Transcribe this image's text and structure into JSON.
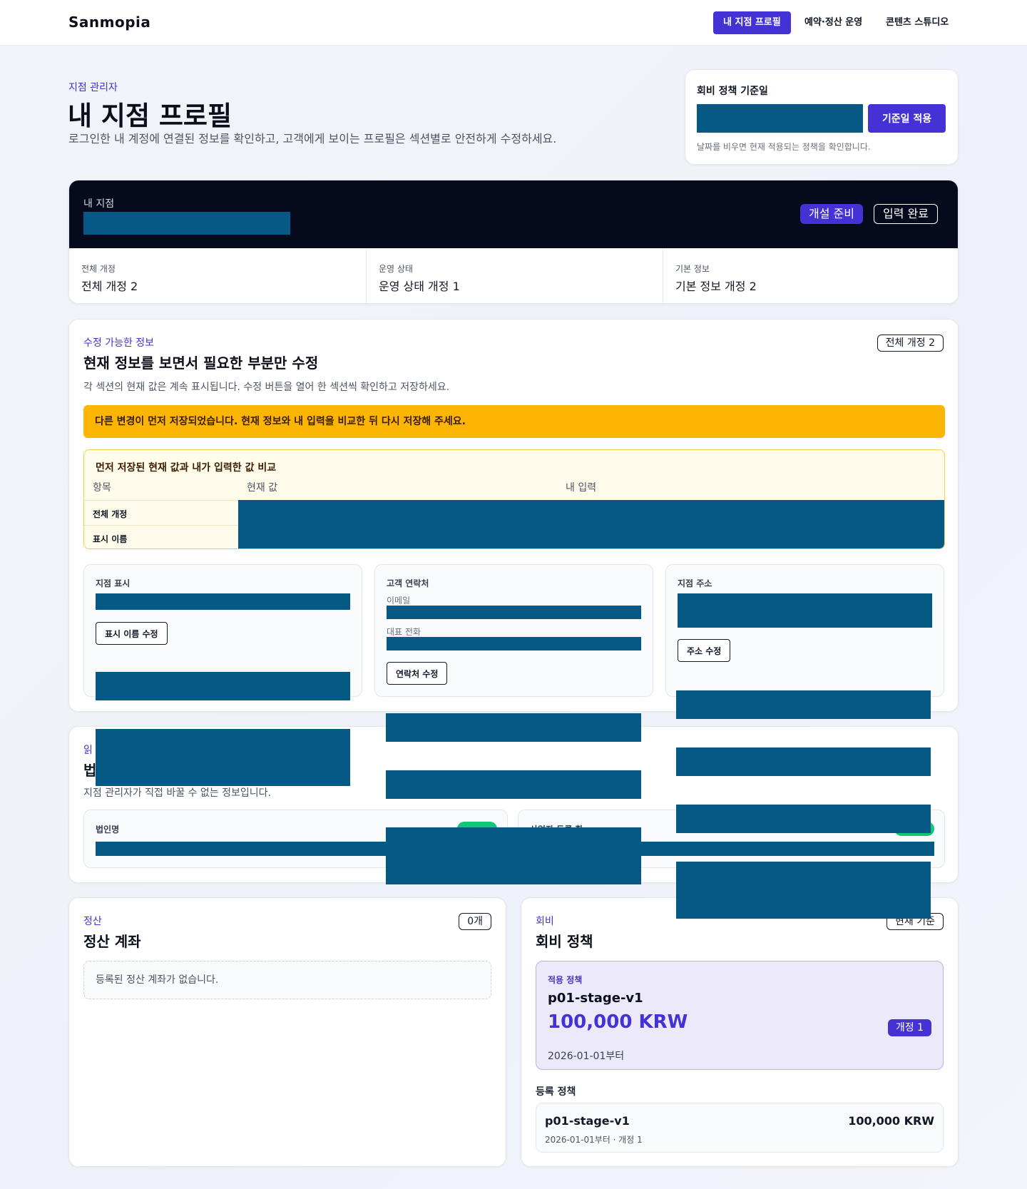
{
  "nav": {
    "brand": "Sanmopia",
    "items": [
      "내 지점 프로필",
      "예약·정산 운영",
      "콘텐츠 스튜디오"
    ]
  },
  "header": {
    "eyebrow": "지점 관리자",
    "title": "내 지점 프로필",
    "description": "로그인한 내 계정에 연결된 정보를 확인하고, 고객에게 보이는 프로필은 섹션별로 안전하게 수정하세요."
  },
  "policy_date": {
    "label": "회비 정책 기준일",
    "apply_button": "기준일 적용",
    "hint": "날짜를 비우면 현재 적용되는 정책을 확인합니다."
  },
  "branch": {
    "label": "내 지점",
    "status_badge": "개설 준비",
    "input_badge": "입력 완료",
    "stats": [
      {
        "label": "전체 개정",
        "value": "전체 개정 2"
      },
      {
        "label": "운영 상태",
        "value": "운영 상태 개정 1"
      },
      {
        "label": "기본 정보",
        "value": "기본 정보 개정 2"
      }
    ]
  },
  "editable": {
    "eyebrow": "수정 가능한 정보",
    "title": "현재 정보를 보면서 필요한 부분만 수정",
    "description": "각 섹션의 현재 값은 계속 표시됩니다. 수정 버튼을 열어 한 섹션씩 확인하고 저장하세요.",
    "revision_badge": "전체 개정 2",
    "alert": "다른 변경이 먼저 저장되었습니다. 현재 정보와 내 입력을 비교한 뒤 다시 저장해 주세요.",
    "compare": {
      "title": "먼저 저장된 현재 값과 내가 입력한 값 비교",
      "headers": [
        "항목",
        "현재 값",
        "내 입력"
      ],
      "rows": [
        "전체 개정",
        "표시 이름"
      ]
    },
    "sections": {
      "display": {
        "title": "지점 표시",
        "button": "표시 이름 수정"
      },
      "contact": {
        "title": "고객 연락처",
        "email_label": "이메일",
        "phone_label": "대표 전화",
        "button": "연락처 수정"
      },
      "address": {
        "title": "지점 주소",
        "button": "주소 수정"
      }
    }
  },
  "readonly": {
    "eyebrow": "읽",
    "title": "법",
    "description": "지점 관리자가 직접 바꿀 수 없는 정보입니다.",
    "fields": [
      {
        "label": "법인명"
      },
      {
        "label": "사업자 등록 확..."
      }
    ]
  },
  "settlement": {
    "eyebrow": "정산",
    "title": "정산 계좌",
    "count_badge": "0개",
    "empty": "등록된 정산 계좌가 없습니다."
  },
  "membership": {
    "eyebrow": "회비",
    "title": "회비 정책",
    "scope_badge": "현재 기준",
    "applied": {
      "label": "적용 정책",
      "name": "p01-stage-v1",
      "price": "100,000 KRW",
      "date": "2026-01-01부터",
      "revision": "개정 1"
    },
    "registered_label": "등록 정책",
    "registered": [
      {
        "name": "p01-stage-v1",
        "price": "100,000 KRW",
        "meta": "2026-01-01부터 · 개정 1"
      }
    ]
  },
  "colors": {
    "accent": "#4432d4",
    "redaction": "#075985",
    "warning": "#fbb502",
    "dark": "#050a1c"
  }
}
